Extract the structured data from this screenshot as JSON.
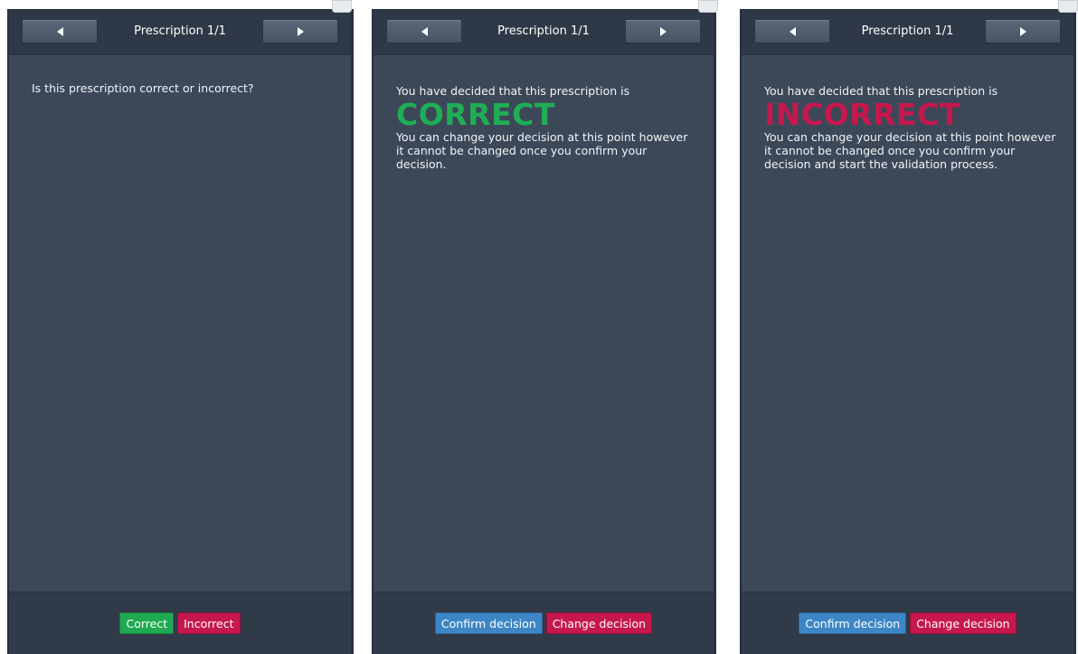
{
  "panels": [
    {
      "header": {
        "title": "Prescription 1/1",
        "prev_icon": "triangle-left-icon",
        "next_icon": "triangle-right-icon"
      },
      "question": "Is this prescription correct or incorrect?",
      "footer": {
        "correct_label": "Correct",
        "incorrect_label": "Incorrect"
      }
    },
    {
      "header": {
        "title": "Prescription 1/1",
        "prev_icon": "triangle-left-icon",
        "next_icon": "triangle-right-icon"
      },
      "intro": "You have decided that this prescription is",
      "decision": "CORRECT",
      "note": "You can change your decision at this point however it cannot be changed once you confirm your decision.",
      "footer": {
        "confirm_label": "Confirm decision",
        "change_label": "Change decision"
      }
    },
    {
      "header": {
        "title": "Prescription 1/1",
        "prev_icon": "triangle-left-icon",
        "next_icon": "triangle-right-icon"
      },
      "intro": "You have decided that this prescription is",
      "decision": "INCORRECT",
      "note": "You can change your decision at this point however it cannot be changed once you confirm your decision and start the validation process.",
      "footer": {
        "confirm_label": "Confirm decision",
        "change_label": "Change decision"
      }
    }
  ],
  "colors": {
    "panel_bg": "#3c4858",
    "header_bg": "#2e3846",
    "correct": "#1faa52",
    "incorrect": "#c6184e",
    "confirm": "#3d86c6"
  }
}
